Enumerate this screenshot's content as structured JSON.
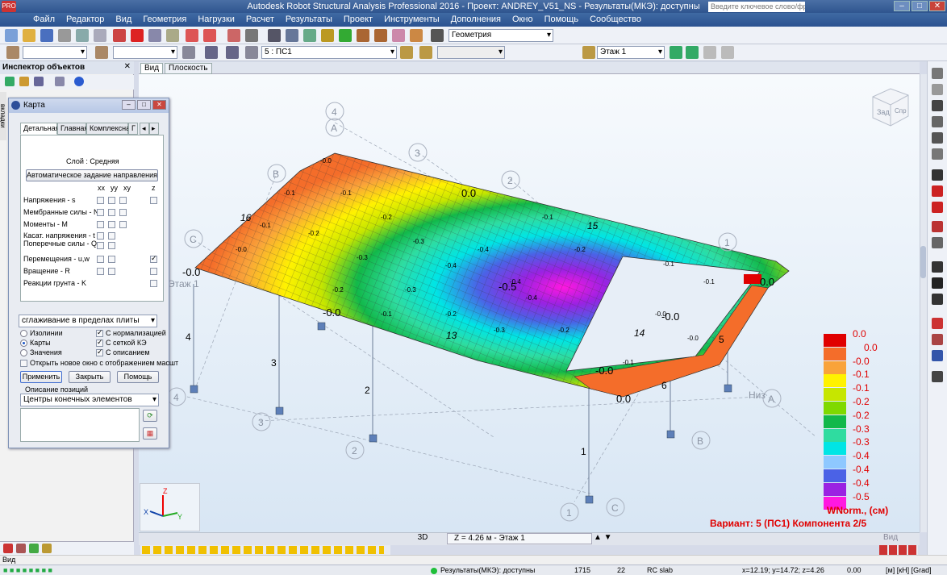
{
  "app": {
    "title": "Autodesk Robot Structural Analysis Professional 2016 - Проект: ANDREY_V51_NS - Результаты(МКЭ): доступны",
    "icon_label": "PRO",
    "search_placeholder": "Введите ключевое слово/фразу"
  },
  "menu": [
    "Файл",
    "Редактор",
    "Вид",
    "Геометрия",
    "Нагрузки",
    "Расчет",
    "Результаты",
    "Проект",
    "Инструменты",
    "Дополнения",
    "Окно",
    "Помощь",
    "Сообщество"
  ],
  "toolbar": {
    "layout_combo": "Геометрия",
    "case_combo": "5 : ПС1",
    "story_combo": "Этаж 1"
  },
  "inspector": {
    "title": "Инспектор объектов",
    "side_tab": "вкладки"
  },
  "view_tabs": [
    "Вид",
    "Плоскость"
  ],
  "karta": {
    "title": "Карта",
    "tabs": [
      "Детальная",
      "Главная",
      "Комплексная",
      "Г"
    ],
    "layer": "Слой : Средняя",
    "auto_dir_button": "Автоматическое задание направления",
    "col_headers": [
      "xx",
      "yy",
      "xy",
      "z"
    ],
    "rows": [
      "Напряжения - s",
      "Мембранные силы - N",
      "Моменты - M",
      "Касат. напряжения - t",
      "Поперечные силы - Q",
      "Перемещения - u,w",
      "Вращение - R",
      "Реакции грунта - K"
    ],
    "smoothing": "сглаживание в пределах плиты",
    "radio": [
      "Изолинии",
      "Карты",
      "Значения"
    ],
    "checks": [
      "С нормализацией",
      "С сеткой КЭ",
      "С описанием"
    ],
    "open_new_window": "Открыть новое окно с отображением масшт",
    "apply": "Применить",
    "close": "Закрыть",
    "help": "Помощь",
    "pos_desc_label": "Описание позиций",
    "pos_desc_value": "Центры конечных элементов"
  },
  "legend": {
    "items": [
      {
        "value": "0.0",
        "color": "#e00000"
      },
      {
        "value": "0.0",
        "color": "#f46d2a"
      },
      {
        "value": "-0.0",
        "color": "#f9a33a"
      },
      {
        "value": "-0.1",
        "color": "#fff200"
      },
      {
        "value": "-0.1",
        "color": "#c6e600"
      },
      {
        "value": "-0.2",
        "color": "#7fd900"
      },
      {
        "value": "-0.2",
        "color": "#12b84a"
      },
      {
        "value": "-0.3",
        "color": "#2fdca0"
      },
      {
        "value": "-0.3",
        "color": "#00e5e5"
      },
      {
        "value": "-0.4",
        "color": "#8ec8ff"
      },
      {
        "value": "-0.4",
        "color": "#4b62e6"
      },
      {
        "value": "-0.4",
        "color": "#9a22e2"
      },
      {
        "value": "-0.5",
        "color": "#ff18e0"
      }
    ],
    "title": "WNorm., (см)",
    "variant": "Вариант: 5 (ПС1) Компонента 2/5"
  },
  "grid_labels": {
    "top": [
      "4",
      "A",
      "3",
      "B",
      "2",
      "C",
      "1"
    ],
    "bottom": [
      "4",
      "3",
      "2",
      "1",
      "C",
      "B",
      "A"
    ],
    "column_numbers": [
      "4",
      "3",
      "2",
      "1",
      "6",
      "5"
    ],
    "edge_numbers": [
      "16",
      "15",
      "14",
      "13"
    ],
    "story_left": "Этаж 1",
    "story_right": "Низ"
  },
  "plot_values": [
    "-0.0",
    "-0.1",
    "-0.2",
    "-0.3",
    "-0.4",
    "-0.5",
    "0.0"
  ],
  "nav_cube": {
    "front": "Зад",
    "side": "Спр"
  },
  "bottom": {
    "mode": "3D",
    "z_level": "Z = 4.26 м - Этаж 1",
    "view": "Вид"
  },
  "vid_label": "Вид",
  "status": {
    "results": "Результаты(МКЭ): доступны",
    "n1": "1715",
    "n2": "22",
    "section": "RC slab",
    "coords": "x=12.19; y=14.72; z=4.26",
    "coord_z": "0.00",
    "units": "[м] [кН] [Grad]"
  }
}
